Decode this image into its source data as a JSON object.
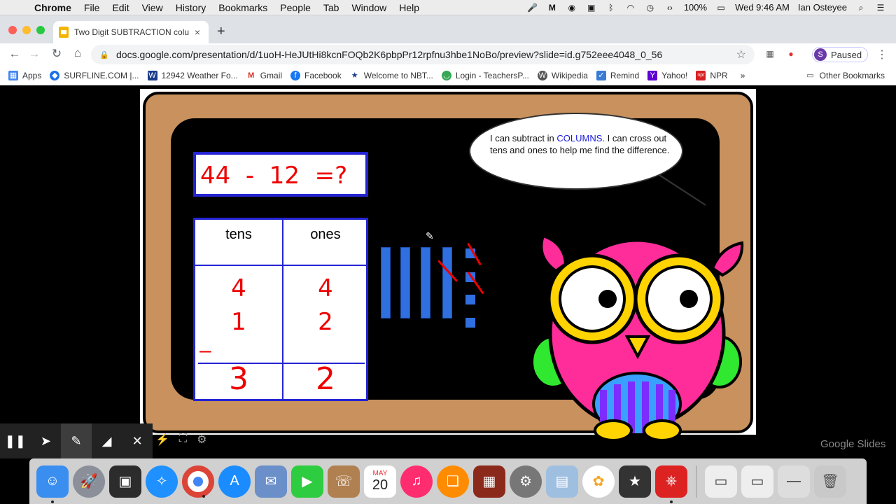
{
  "menubar": {
    "app": "Chrome",
    "items": [
      "File",
      "Edit",
      "View",
      "History",
      "Bookmarks",
      "People",
      "Tab",
      "Window",
      "Help"
    ],
    "battery": "100%",
    "datetime": "Wed 9:46 AM",
    "user": "Ian Osteyee"
  },
  "tab": {
    "title": "Two Digit SUBTRACTION colu",
    "close": "×",
    "new_tab": "+"
  },
  "toolbar": {
    "url": "docs.google.com/presentation/d/1uoH-HeJUtHi8kcnFOQb2K6pbpPr12rpfnu3hbe1NoBo/preview?slide=id.g752eee4048_0_56",
    "profile_initial": "S",
    "profile_status": "Paused"
  },
  "bookmarks": {
    "items": [
      {
        "label": "Apps",
        "icon": "apps-icon",
        "color": "#4285f4"
      },
      {
        "label": "SURFLINE.COM |...",
        "icon": "surfline-icon",
        "color": "#1a73e8"
      },
      {
        "label": "12942 Weather Fo...",
        "icon": "weather-icon",
        "color": "#1b3a8a"
      },
      {
        "label": "Gmail",
        "icon": "gmail-icon",
        "color": "#d93025"
      },
      {
        "label": "Facebook",
        "icon": "facebook-icon",
        "color": "#1877f2"
      },
      {
        "label": "Welcome to NBT...",
        "icon": "star-icon",
        "color": "#1a3d8f"
      },
      {
        "label": "Login - TeachersP...",
        "icon": "teachers-icon",
        "color": "#34a853"
      },
      {
        "label": "Wikipedia",
        "icon": "wikipedia-icon",
        "color": "#555555"
      },
      {
        "label": "Remind",
        "icon": "remind-icon",
        "color": "#3a7bd5"
      },
      {
        "label": "Yahoo!",
        "icon": "yahoo-icon",
        "color": "#6001d2"
      },
      {
        "label": "NPR",
        "icon": "npr-icon",
        "color": "#d62021"
      }
    ],
    "overflow": "»",
    "other": "Other Bookmarks"
  },
  "slide": {
    "equation": "44  -  12  =?",
    "table": {
      "headers": [
        "tens",
        "ones"
      ],
      "row1": [
        "4",
        "4"
      ],
      "row2": [
        "1",
        "2"
      ],
      "minus": "–",
      "answer": [
        "3",
        "2"
      ]
    },
    "bubble": {
      "text_before": "I can subtract in ",
      "highlight": "COLUMNS",
      "text_after": ". I can cross out tens and ones  to help me find the difference."
    }
  },
  "player": {
    "brand": "Google Slides"
  },
  "dock": {
    "calendar_month": "MAY",
    "calendar_day": "20"
  }
}
